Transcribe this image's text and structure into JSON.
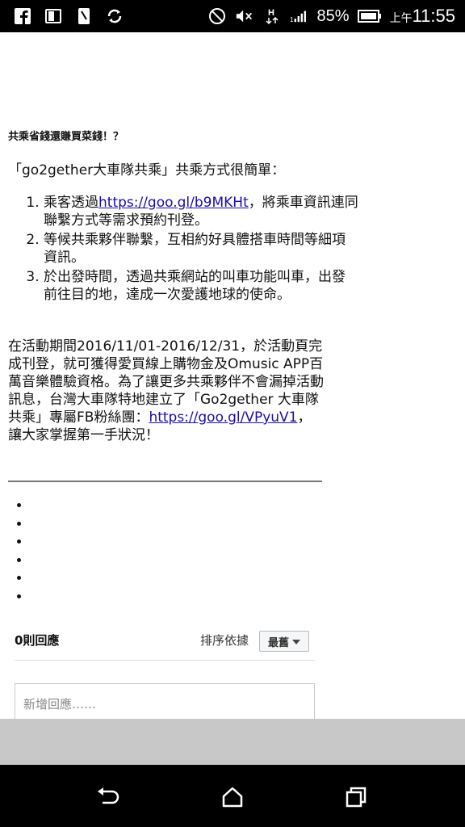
{
  "status_bar": {
    "left_icons": [
      "facebook-icon",
      "tablet-icon",
      "phone-icon",
      "sync-icon"
    ],
    "right_icons": [
      "do-not-disturb-icon",
      "mute-icon",
      "data-h-icon",
      "signal-icon",
      "battery-icon"
    ],
    "battery_percent": "85%",
    "time_prefix": "上午",
    "time": "11:55"
  },
  "article": {
    "title": "共乘省錢還賺買菜錢！？",
    "intro": "「go2gether大車隊共乘」共乘方式很簡單：",
    "steps": [
      {
        "before": "乘客透過",
        "link": "https://goo.gl/b9MKHt",
        "after": "，將乘車資訊連同聯繫方式等需求預約刊登。"
      },
      {
        "text": "等候共乘夥伴聯繫，互相約好具體搭車時間等細項資訊。"
      },
      {
        "text": "於出發時間，透過共乘網站的叫車功能叫車，出發前往目的地，達成一次愛護地球的使命。"
      }
    ],
    "paragraph_before": "在活動期間2016/11/01-2016/12/31，於活動頁完成刊登，就可獲得愛買線上購物金及Omusic APP百萬音樂體驗資格。為了讓更多共乘夥伴不會漏掉活動訊息，台灣大車隊特地建立了「Go2gether 大車隊共乘」專屬FB粉絲團：",
    "paragraph_link": "https://goo.gl/VPyuV1",
    "paragraph_after": "，讓大家掌握第一手狀況！",
    "bullet_count": 6
  },
  "comments": {
    "count_label": "0則回應",
    "sort_label": "排序依據",
    "sort_value": "最舊",
    "input_placeholder": "新增回應……"
  },
  "nav": {
    "icons": [
      "back-icon",
      "home-icon",
      "recent-apps-icon"
    ]
  }
}
